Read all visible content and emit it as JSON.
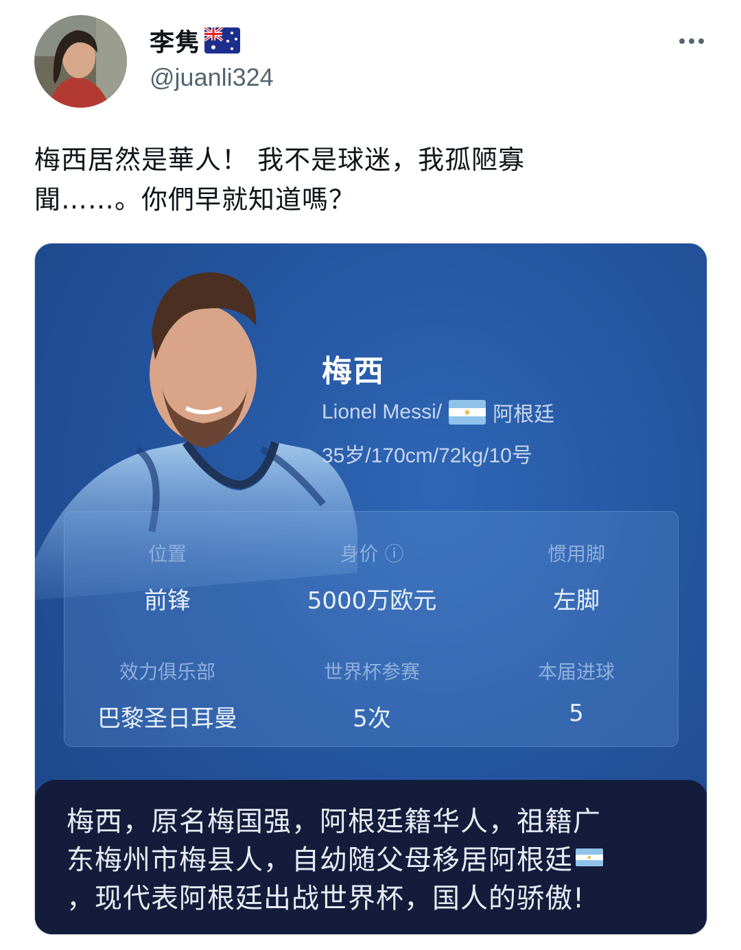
{
  "author": {
    "display_name": "李隽",
    "flag_icon": "australia-flag-icon",
    "handle": "@juanli324"
  },
  "tweet": {
    "text_lines": [
      "梅西居然是華人！ 我不是球迷，我孤陋寡",
      "聞……。你們早就知道嗎？"
    ]
  },
  "card": {
    "name": "梅西",
    "english_name": "Lionel Messi/",
    "country": "阿根廷",
    "profile": "35岁/170cm/72kg/10号",
    "stats": [
      {
        "label": "位置",
        "value": "前锋"
      },
      {
        "label": "身价 ⓘ",
        "value": "5000万欧元"
      },
      {
        "label": "惯用脚",
        "value": "左脚"
      },
      {
        "label": "效力俱乐部",
        "value": "巴黎圣日耳曼"
      },
      {
        "label": "世界杯参赛",
        "value": "5次"
      },
      {
        "label": "本届进球",
        "value": "5"
      }
    ],
    "caption_lines": [
      "梅西，原名梅国强，阿根廷籍华人，祖籍广",
      "东梅州市梅县人，自幼随父母移居阿根廷",
      "，现代表阿根廷出战世界杯，国人的骄傲!"
    ]
  },
  "colors": {
    "card_blue": "#24559f",
    "caption_bg": "#151b3a",
    "handle_gray": "#536471"
  }
}
